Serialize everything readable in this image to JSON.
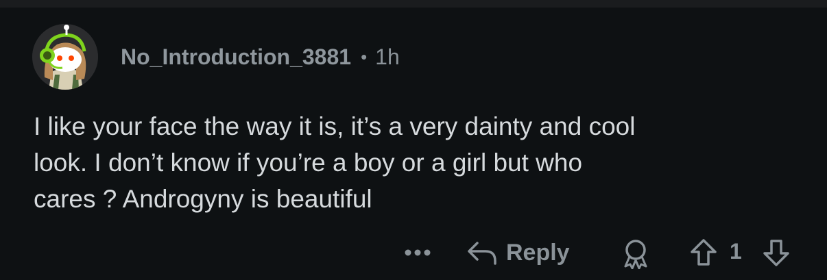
{
  "comment": {
    "username": "No_Introduction_3881",
    "separator": "•",
    "time": "1h",
    "body": "I like your face the way it is, it’s a very dainty and cool\nlook. I don’t know if you’re a boy or a girl but who\ncares ? Androgyny is beautiful"
  },
  "actions": {
    "more_icon": "more-dots-icon",
    "reply_icon": "reply-arrow-icon",
    "reply_label": "Reply",
    "award_icon": "award-icon",
    "upvote_icon": "upvote-arrow-icon",
    "score": "1",
    "downvote_icon": "downvote-arrow-icon"
  },
  "colors": {
    "background": "#0e1113",
    "text": "#d6dadd",
    "muted": "#8b9399"
  }
}
